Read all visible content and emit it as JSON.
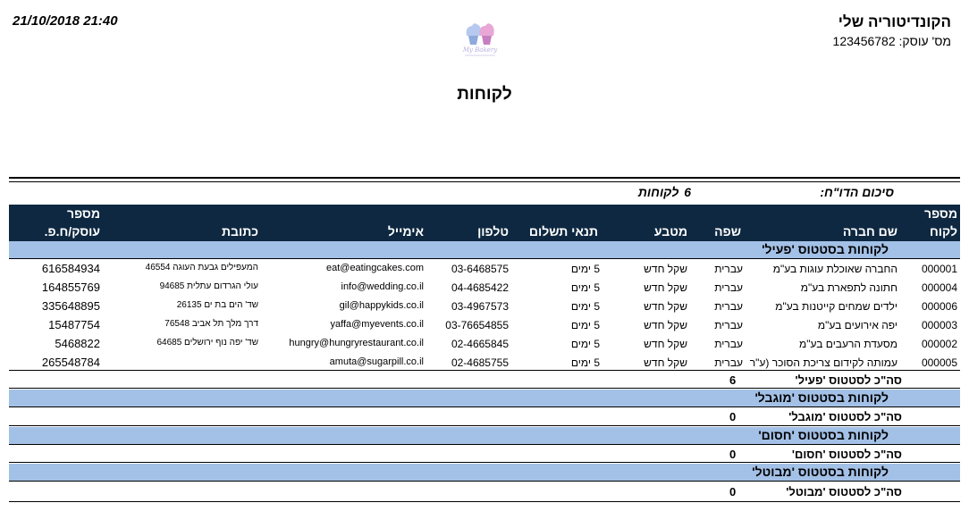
{
  "report": {
    "datetime": "21/10/2018 21:40",
    "company_name": "הקונדיטוריה שלי",
    "business_id_label": "מס' עוסק:",
    "business_id": "123456782",
    "logo_text": "My Bakery",
    "title": "לקוחות",
    "summary_label": "סיכום הדו\"ח:",
    "summary_count": "6",
    "summary_count_label": "לקוחות"
  },
  "columns": {
    "customer_no": [
      "מספר",
      "לקוח"
    ],
    "company": "שם חברה",
    "language": "שפה",
    "currency": "מטבע",
    "payment_terms": "תנאי תשלום",
    "phone": "טלפון",
    "email": "אימייל",
    "address": "כתובת",
    "business_no": [
      "מספר",
      "עוסק/ח.פ."
    ]
  },
  "groups": [
    {
      "header": "לקוחות בסטטוס 'פעיל'",
      "rows": [
        {
          "no": "000001",
          "company": "החברה שאוכלת עוגות בע\"מ",
          "language": "עברית",
          "currency": "שקל חדש",
          "terms": "5 ימים",
          "phone": "03-6468575",
          "email": "eat@eatingcakes.com",
          "address": "המעפילים גבעת העוגה 46554",
          "business_no": "616584934"
        },
        {
          "no": "000004",
          "company": "חתונה לתפארת בע\"מ",
          "language": "עברית",
          "currency": "שקל חדש",
          "terms": "5 ימים",
          "phone": "04-4685422",
          "email": "info@wedding.co.il",
          "address": "עולי הגרדום עתלית 94685",
          "business_no": "164855769"
        },
        {
          "no": "000006",
          "company": "ילדים שמחים קייטנות בע\"מ",
          "language": "עברית",
          "currency": "שקל חדש",
          "terms": "5 ימים",
          "phone": "03-4967573",
          "email": "gil@happykids.co.il",
          "address": "שד' הים בת ים 26135",
          "business_no": "335648895"
        },
        {
          "no": "000003",
          "company": "יפה אירועים בע\"מ",
          "language": "עברית",
          "currency": "שקל חדש",
          "terms": "5 ימים",
          "phone": "03-76654855",
          "email": "yaffa@myevents.co.il",
          "address": "דרך מלך תל אביב 76548",
          "business_no": "15487754"
        },
        {
          "no": "000002",
          "company": "מסעדת הרעבים בע\"מ",
          "language": "עברית",
          "currency": "שקל חדש",
          "terms": "5 ימים",
          "phone": "02-4665845",
          "email": "hungry@hungryrestaurant.co.il",
          "address": "שד' יפה נוף ירושלים 64685",
          "business_no": "5468822"
        },
        {
          "no": "000005",
          "company": "עמותה לקידום צריכת הסוכר (ע\"ר",
          "language": "עברית",
          "currency": "שקל חדש",
          "terms": "5 ימים",
          "phone": "02-4685755",
          "email": "amuta@sugarpill.co.il",
          "address": "",
          "business_no": "265548784"
        }
      ],
      "total_label": "סה\"כ לסטטוס 'פעיל'",
      "total_value": "6"
    },
    {
      "header": "לקוחות בסטטוס 'מוגבל'",
      "rows": [],
      "total_label": "סה\"כ לסטטוס 'מוגבל'",
      "total_value": "0"
    },
    {
      "header": "לקוחות בסטטוס 'חסום'",
      "rows": [],
      "total_label": "סה\"כ לסטטוס 'חסום'",
      "total_value": "0"
    },
    {
      "header": "לקוחות בסטטוס 'מבוטל'",
      "rows": [],
      "total_label": "סה\"כ לסטטוס 'מבוטל'",
      "total_value": "0"
    }
  ],
  "colors": {
    "header_bg": "#0e2841",
    "section_bg": "#a3c0e6"
  }
}
